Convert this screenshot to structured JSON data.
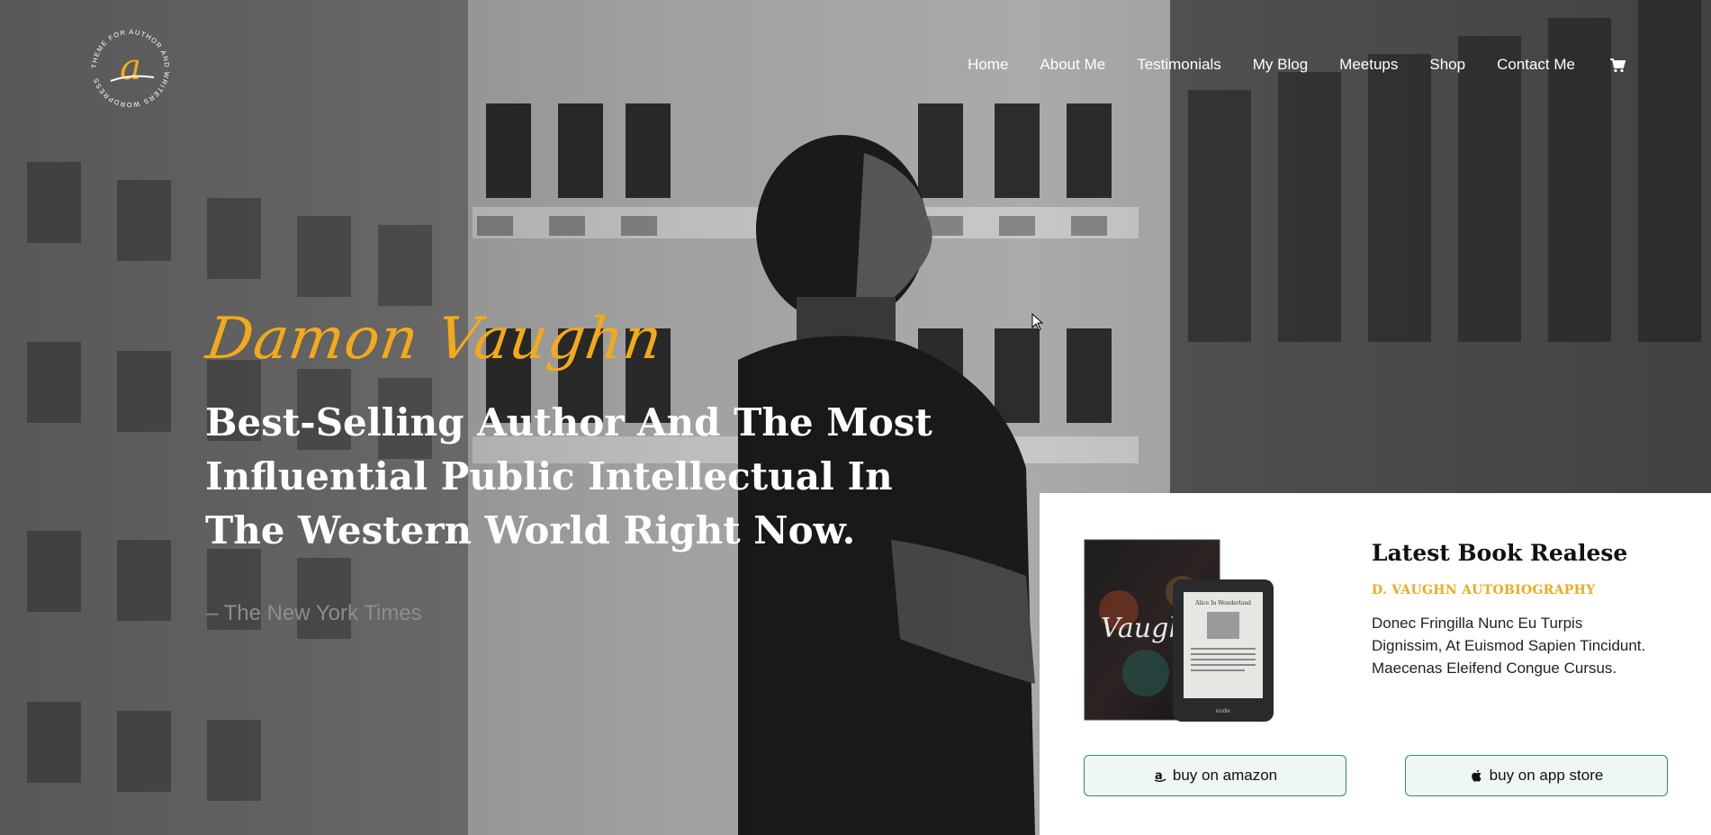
{
  "site": {
    "logo_ring_text": "THEME FOR AUTHOR AND WRITERS WORDPRESS",
    "logo_letter": "a"
  },
  "nav": {
    "items": [
      {
        "label": "Home"
      },
      {
        "label": "About Me"
      },
      {
        "label": "Testimonials"
      },
      {
        "label": "My Blog"
      },
      {
        "label": "Meetups"
      },
      {
        "label": "Shop"
      },
      {
        "label": "Contact Me"
      }
    ],
    "cart_icon": "cart-icon"
  },
  "hero": {
    "signature": "Damon Vaughn",
    "headline": "Best-Selling Author And The Most Influential Public Intellectual In The Western World Right Now.",
    "source": "– The New York Times"
  },
  "book": {
    "title": "Latest Book Realese",
    "subtitle": "D. VAUGHN AUTOBIOGRAPHY",
    "description": "Donec Fringilla Nunc Eu Turpis Dignissim, At Euismod Sapien Tincidunt. Maecenas Eleifend Congue Cursus.",
    "cover_text": "Vaughn",
    "ereader_title": "Alice In Wonderland",
    "ereader_brand": "kindle",
    "buy_amazon": "buy on amazon",
    "buy_app_store": "buy on app store"
  },
  "colors": {
    "accent": "#f2a91a",
    "button_border": "#2f8c73",
    "button_bg": "#eef7f4"
  }
}
